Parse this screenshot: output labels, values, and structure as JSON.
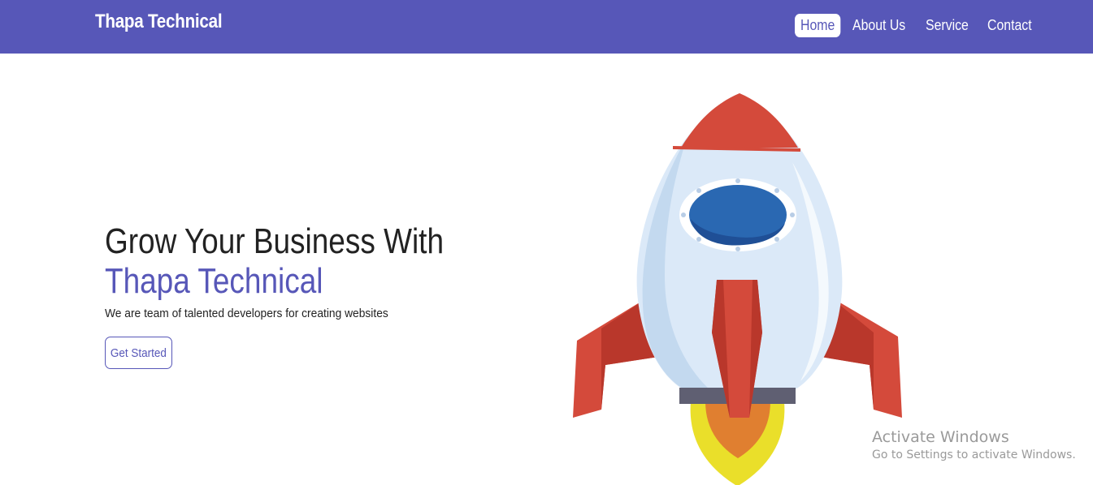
{
  "navbar": {
    "brand": "Thapa Technical",
    "links": [
      {
        "label": "Home",
        "active": true
      },
      {
        "label": "About Us",
        "active": false
      },
      {
        "label": "Service",
        "active": false
      },
      {
        "label": "Contact",
        "active": false
      }
    ]
  },
  "hero": {
    "heading": "Grow Your Business With",
    "brand": "Thapa Technical",
    "subtitle": "We are team of talented developers for creating websites",
    "cta_label": "Get Started"
  },
  "watermark": {
    "title": "Activate Windows",
    "subtitle": "Go to Settings to activate Windows."
  },
  "colors": {
    "primary": "#5757b8",
    "text": "#222222",
    "rocket_red": "#d44a3b",
    "rocket_body": "#dbe9f8",
    "window_blue": "#2a68b2",
    "flame_yellow": "#eadf2a"
  },
  "icons": {
    "hero_illustration": "rocket-illustration"
  }
}
